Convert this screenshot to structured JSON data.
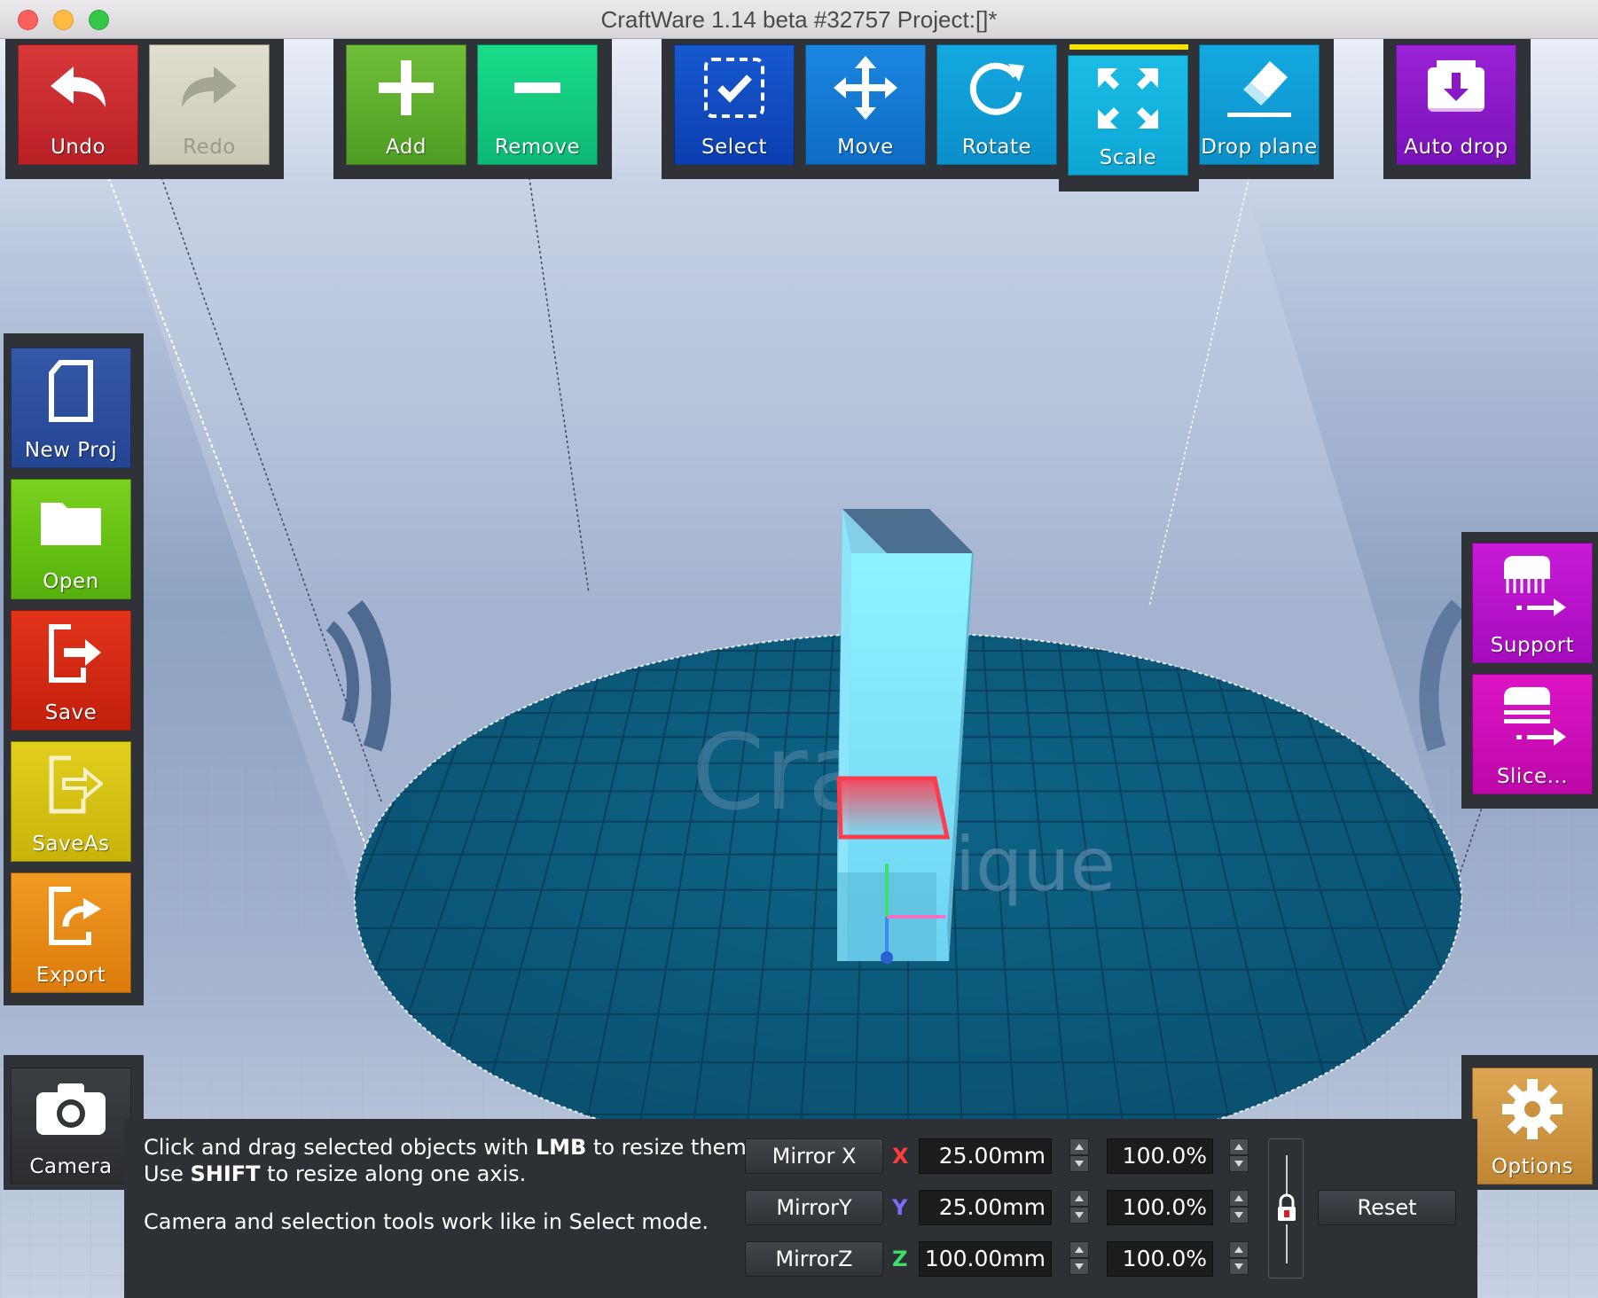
{
  "window": {
    "title": "CraftWare 1.14 beta #32757    Project:[]*"
  },
  "toolbar": {
    "undo": "Undo",
    "redo": "Redo",
    "add": "Add",
    "remove": "Remove",
    "select": "Select",
    "move": "Move",
    "rotate": "Rotate",
    "scale": "Scale",
    "drop_plane": "Drop plane",
    "auto_drop": "Auto drop",
    "active_tool": "Scale"
  },
  "left_panel": {
    "new_proj": "New Proj",
    "open": "Open",
    "save": "Save",
    "save_as": "SaveAs",
    "export": "Export",
    "camera": "Camera"
  },
  "right_panel": {
    "support": "Support",
    "slice": "Slice...",
    "options": "Options"
  },
  "help": {
    "line1_a": "Click and drag selected objects with ",
    "line1_b": "LMB",
    "line1_c": " to resize them.",
    "line2_a": "Use ",
    "line2_b": "SHIFT",
    "line2_c": " to resize along one axis.",
    "line3": "Camera and selection tools work like in Select mode."
  },
  "scale_panel": {
    "mirror_x": "Mirror X",
    "mirror_y": "MirrorY",
    "mirror_z": "MirrorZ",
    "x_label": "X",
    "y_label": "Y",
    "z_label": "Z",
    "x_size": "25.00mm",
    "y_size": "25.00mm",
    "z_size": "100.00mm",
    "x_percent": "100.0%",
    "y_percent": "100.0%",
    "z_percent": "100.0%",
    "reset": "Reset",
    "uniform_locked": true
  },
  "colors": {
    "axis_x": "#ff3b3b",
    "axis_y": "#7b6cff",
    "axis_z": "#3fe06a",
    "active_indicator": "#f5e300"
  },
  "icons": {
    "undo": "undo-arrow-icon",
    "redo": "redo-arrow-icon",
    "add": "plus-icon",
    "remove": "minus-icon",
    "select": "select-check-icon",
    "move": "move-arrows-icon",
    "rotate": "rotate-icon",
    "scale": "scale-arrows-icon",
    "drop_plane": "eraser-icon",
    "auto_drop": "drop-box-icon",
    "new_proj": "new-document-icon",
    "open": "folder-icon",
    "save": "save-icon",
    "save_as": "save-as-icon",
    "export": "export-icon",
    "camera": "camera-icon",
    "support": "support-icon",
    "slice": "slice-icon",
    "options": "gear-icon",
    "lock": "lock-icon"
  },
  "watermark": {
    "line1": "Craft",
    "line2": "Unique"
  }
}
